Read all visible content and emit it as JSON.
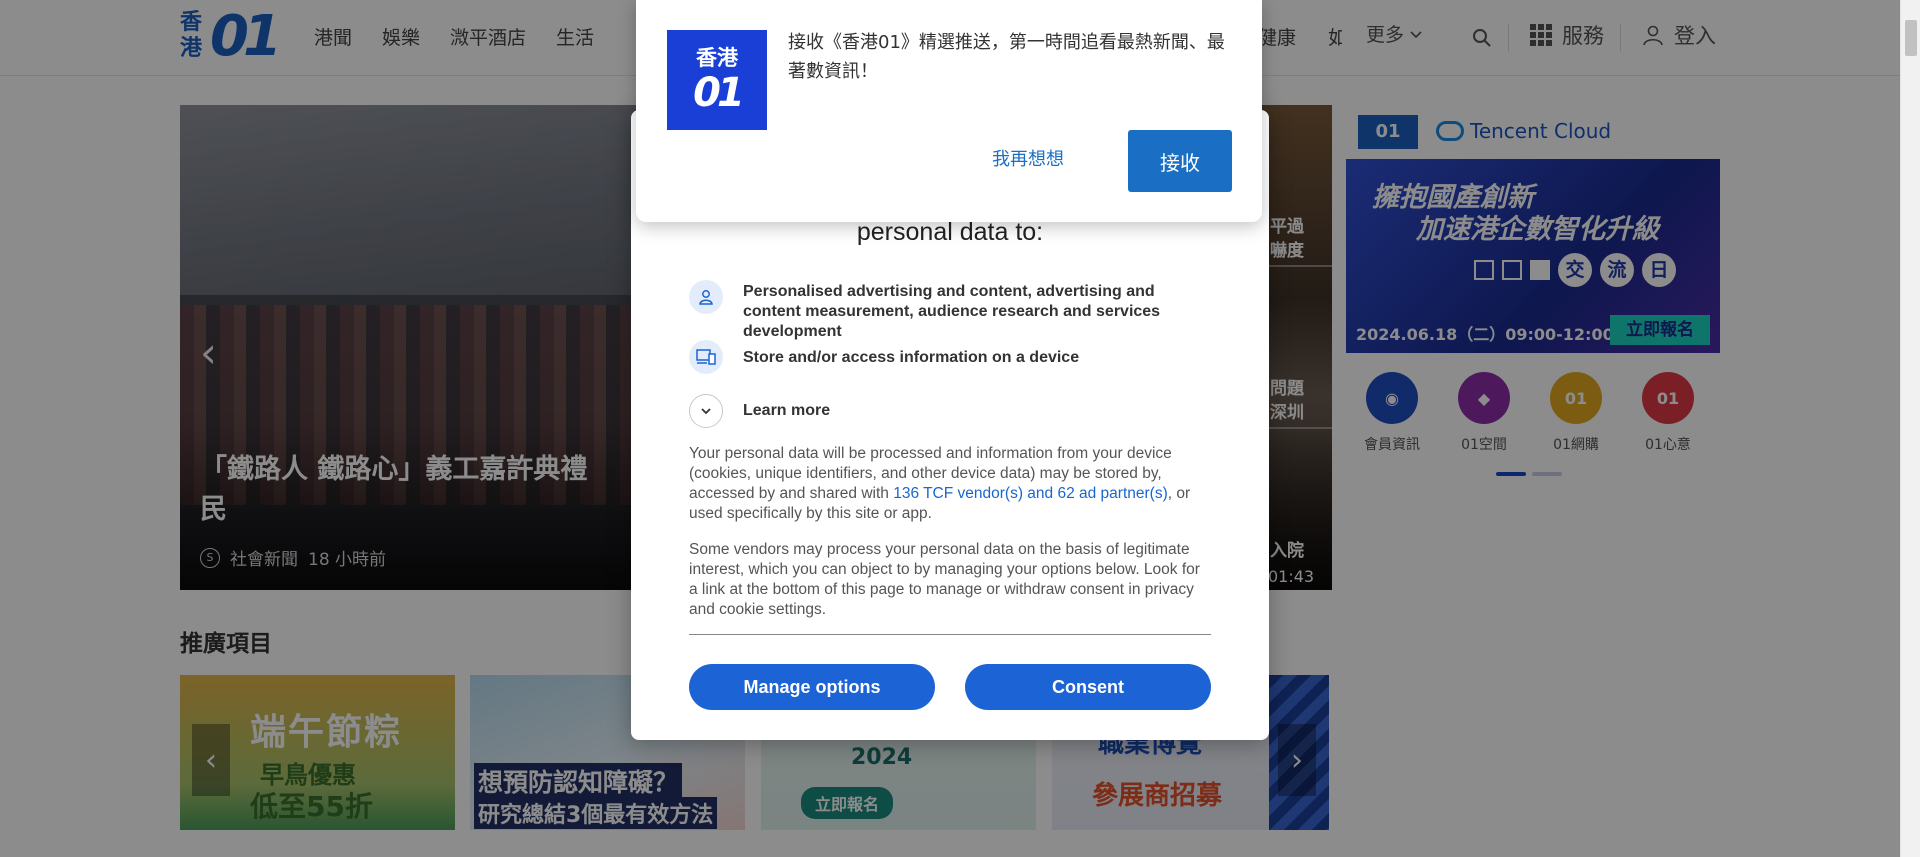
{
  "header": {
    "logo_hk": "香港",
    "logo_01": "01",
    "nav": [
      "港聞",
      "娛樂",
      "溦平酒店",
      "生活"
    ],
    "nav_tail": [
      "健康",
      "如"
    ],
    "more": "更多",
    "services": "服務",
    "login": "登入"
  },
  "hero": {
    "title": "「鐵路人 鐵路心」義工嘉許典禮",
    "title_line2": "民",
    "category": "社會新聞",
    "time": "18 小時前",
    "side_snippets": [
      "平過",
      "嚇度",
      "問題",
      "深圳",
      "入院"
    ],
    "duration": "01:43"
  },
  "ad": {
    "brand": "Tencent Cloud",
    "line1": "擁抱國產創新",
    "line2": "加速港企數智化升級",
    "badge_chars": [
      "交",
      "流",
      "日"
    ],
    "date": "2024.06.18（二）09:00-12:00",
    "cta": "立即報名"
  },
  "quick_links": [
    {
      "label": "會員資訊",
      "color": "#1f4fc2",
      "glyph": "◉"
    },
    {
      "label": "01空間",
      "color": "#8f2fa8",
      "glyph": "◆"
    },
    {
      "label": "01網購",
      "color": "#e0a820",
      "glyph": "01"
    },
    {
      "label": "01心意",
      "color": "#e03a45",
      "glyph": "01"
    }
  ],
  "promo": {
    "section_title": "推廣項目",
    "p1": {
      "a": "端午節粽",
      "b": "早鳥優惠",
      "c": "低至55折"
    },
    "p2": {
      "a": "想預防認知障礙？",
      "b": "研究總結3個最有效方法"
    },
    "p3": {
      "a": "2024",
      "b": "立即報名"
    },
    "p4": {
      "a": "職業博覽",
      "b": "參展商招募"
    }
  },
  "consent": {
    "heading": "personal data to:",
    "purpose1": "Personalised advertising and content, advertising and content measurement, audience research and services development",
    "purpose2": "Store and/or access information on a device",
    "learn_more": "Learn more",
    "para1_a": "Your personal data will be processed and information from your device (cookies, unique identifiers, and other device data) may be stored by, accessed by and shared with ",
    "para1_link": "136 TCF vendor(s) and 62 ad partner(s)",
    "para1_b": ", or used specifically by this site or app.",
    "para2": "Some vendors may process your personal data on the basis of legitimate interest, which you can object to by managing your options below. Look for a link at the bottom of this page to manage or withdraw consent in privacy and cookie settings.",
    "manage_btn": "Manage options",
    "consent_btn": "Consent"
  },
  "push": {
    "logo_top": "香港",
    "logo_bottom": "01",
    "message": "接收《香港01》精選推送，第一時間追看最熱新聞、最著數資訊！",
    "later_btn": "我再想想",
    "accept_btn": "接收"
  }
}
